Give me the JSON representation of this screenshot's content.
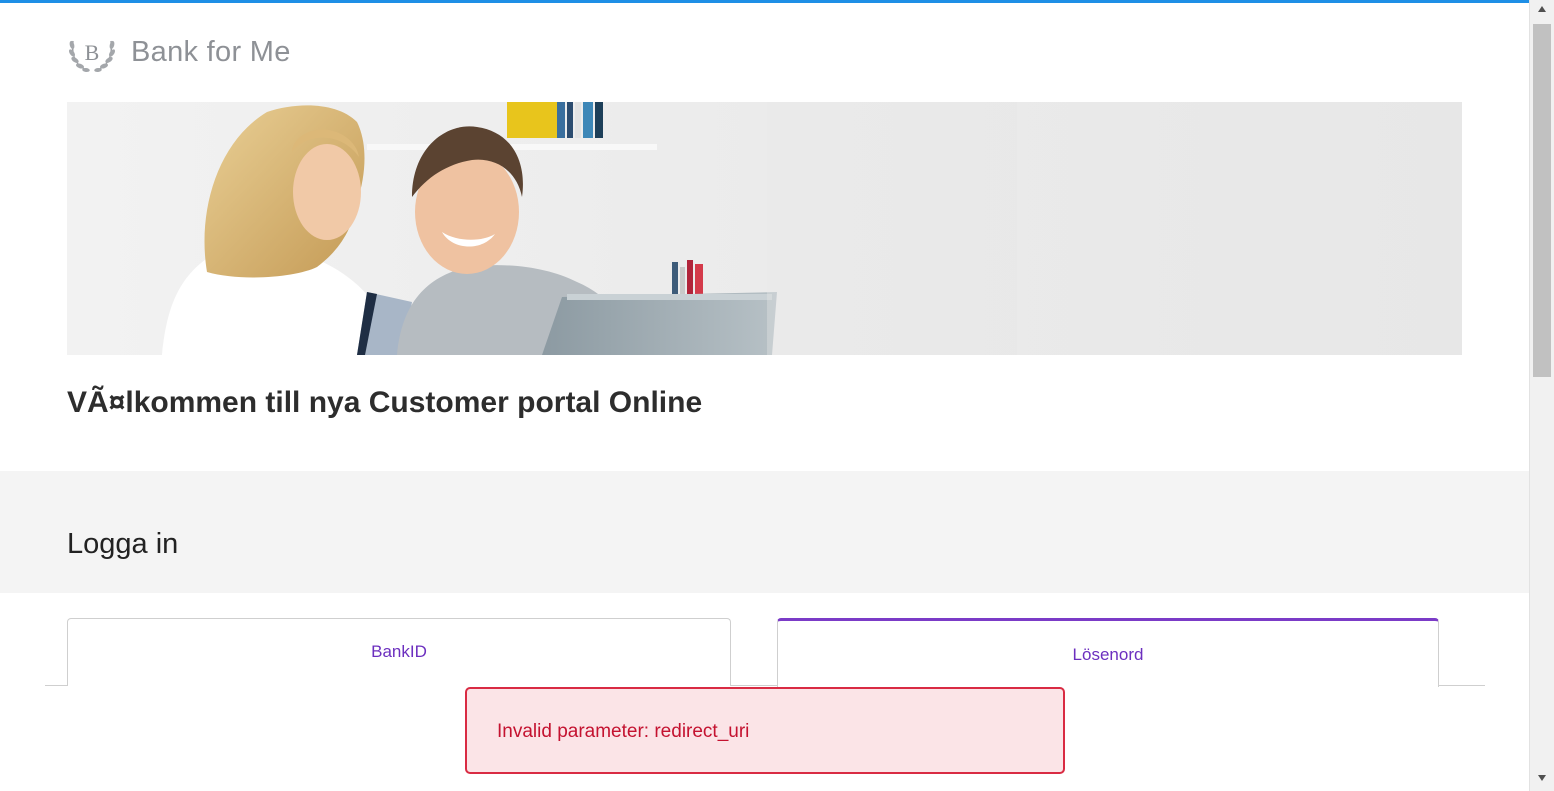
{
  "header": {
    "logo_monogram": "B",
    "brand_name": "Bank for Me"
  },
  "hero": {
    "image_alt": "couple-with-laptop-and-card"
  },
  "main": {
    "welcome_title": "VÃ¤lkommen till nya Customer portal Online"
  },
  "login": {
    "title": "Logga in",
    "tabs": [
      {
        "label": "BankID",
        "active": false
      },
      {
        "label": "Lösenord",
        "active": true
      }
    ],
    "error_message": "Invalid parameter: redirect_uri"
  },
  "colors": {
    "accent": "#7b3bc7",
    "tab_text": "#6c2fbf",
    "error_border": "#d92b43",
    "error_bg": "#fbe4e7",
    "error_text": "#c41230",
    "top_bar": "#1e8fe6"
  },
  "scrollbar": {
    "up_icon": "triangle-up-icon",
    "down_icon": "triangle-down-icon"
  }
}
